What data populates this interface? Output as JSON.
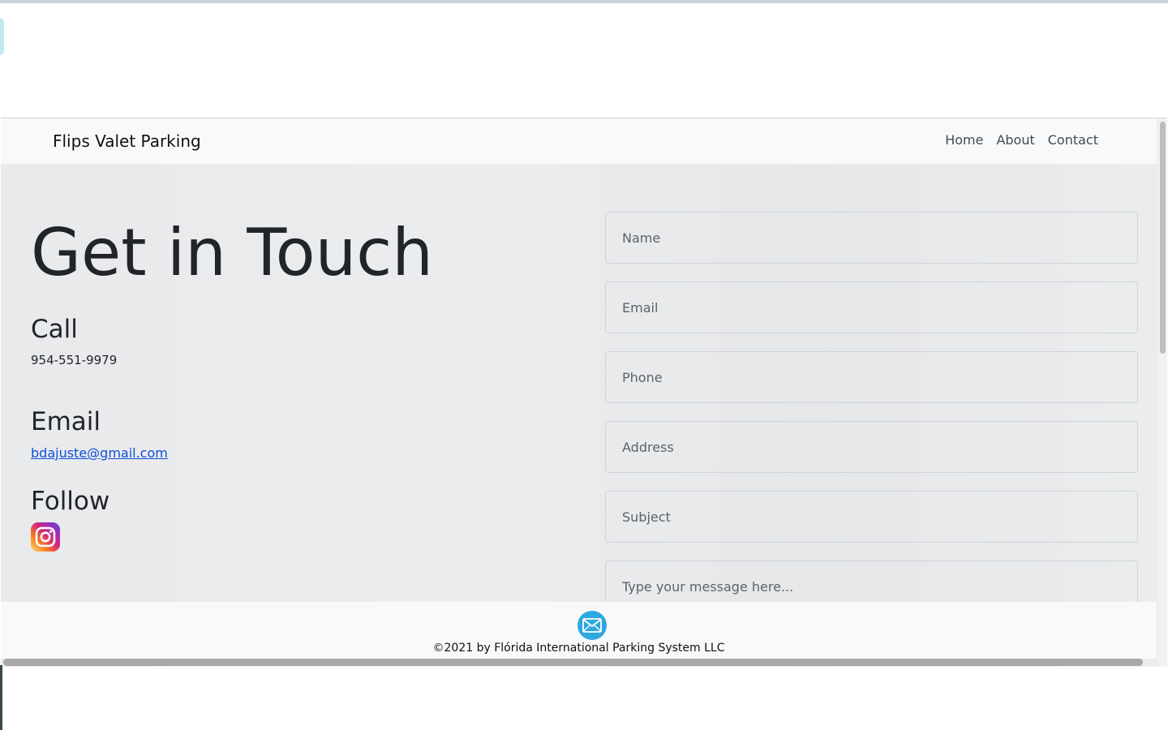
{
  "navbar": {
    "brand": "Flips Valet Parking",
    "links": [
      "Home",
      "About",
      "Contact"
    ]
  },
  "hero": {
    "title": "Get in Touch"
  },
  "contact": {
    "call_heading": "Call",
    "phone": "954-551-9979",
    "email_heading": "Email",
    "email": "bdajuste@gmail.com",
    "follow_heading": "Follow",
    "social_icon": "instagram-icon"
  },
  "form": {
    "name_placeholder": "Name",
    "email_placeholder": "Email",
    "phone_placeholder": "Phone",
    "address_placeholder": "Address",
    "subject_placeholder": "Subject",
    "message_placeholder": "Type your message here..."
  },
  "footer": {
    "icon": "mail-icon",
    "copyright": "©2021 by Flórida International Parking System LLC"
  },
  "colors": {
    "navbar_bg": "#f8f9fa",
    "page_bg": "#e9eaec",
    "link": "#0d4fd6",
    "mail_button": "#2ea8de"
  }
}
